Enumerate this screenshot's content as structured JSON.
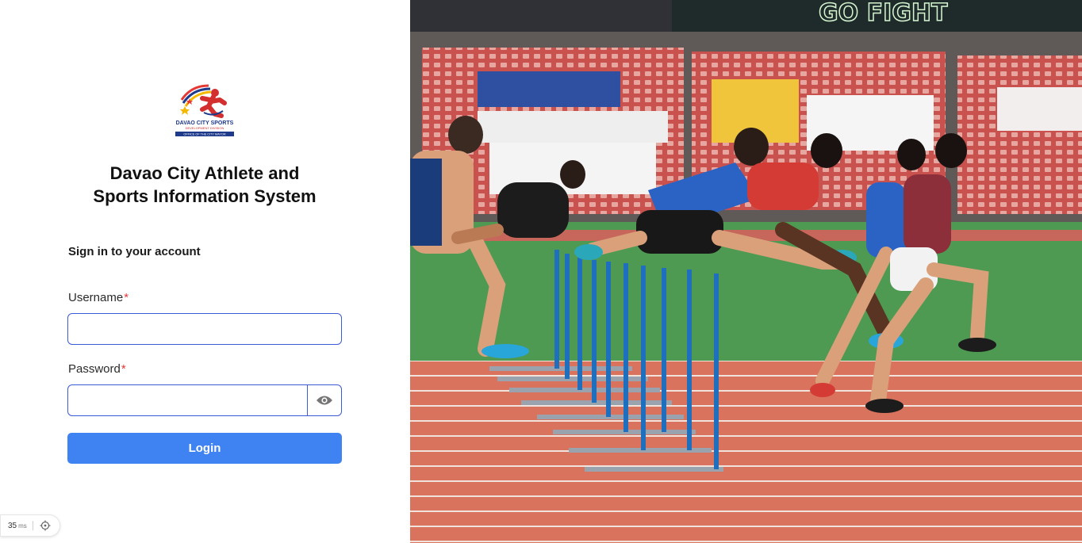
{
  "app": {
    "logo_lines": [
      "DAVAO CITY SPORTS",
      "DEVELOPMENT DIVISION",
      "OFFICE OF THE CITY MAYOR"
    ],
    "title_line1": "Davao City Athlete and",
    "title_line2": "Sports Information System"
  },
  "form": {
    "heading": "Sign in to your account",
    "username_label": "Username",
    "username_value": "",
    "password_label": "Password",
    "password_value": "",
    "required_mark": "*",
    "login_label": "Login"
  },
  "icons": {
    "toggle_password": "eye-icon",
    "crosshair": "crosshair-icon"
  },
  "hero": {
    "banner_text": "GO FIGHT",
    "image_subject": "hurdles-race"
  },
  "debug": {
    "timer_value": "35",
    "timer_unit": "ms"
  },
  "colors": {
    "accent": "#3f82f1",
    "input_border": "#3b5cd6",
    "required": "#e53935",
    "track": "#d9735e",
    "field": "#4e9a52"
  }
}
